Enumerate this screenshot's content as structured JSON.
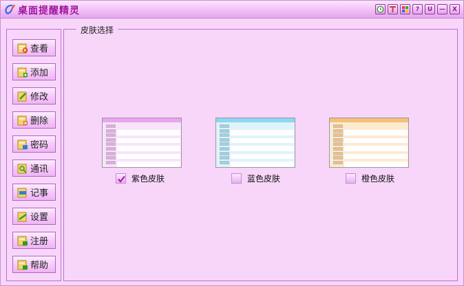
{
  "window": {
    "title": "桌面提醒精灵",
    "accent": "#a0169e",
    "toolbar_buttons": [
      {
        "name": "clock-button",
        "glyph": "◷"
      },
      {
        "name": "pin-button",
        "glyph": "T"
      },
      {
        "name": "skin-button",
        "glyph": "▦"
      },
      {
        "name": "help-button",
        "glyph": "?"
      },
      {
        "name": "magnet-button",
        "glyph": "U"
      },
      {
        "name": "minimize-button",
        "glyph": "—"
      },
      {
        "name": "close-button",
        "glyph": "X"
      }
    ]
  },
  "sidebar": {
    "items": [
      {
        "label": "查看",
        "icon": "view-icon"
      },
      {
        "label": "添加",
        "icon": "add-icon"
      },
      {
        "label": "修改",
        "icon": "edit-icon"
      },
      {
        "label": "删除",
        "icon": "delete-icon"
      },
      {
        "label": "密码",
        "icon": "password-icon"
      },
      {
        "label": "通讯",
        "icon": "contacts-icon"
      },
      {
        "label": "记事",
        "icon": "notes-icon"
      },
      {
        "label": "设置",
        "icon": "settings-icon"
      },
      {
        "label": "注册",
        "icon": "register-icon"
      },
      {
        "label": "帮助",
        "icon": "help-icon"
      }
    ]
  },
  "skin_panel": {
    "legend": "皮肤选择",
    "skins": [
      {
        "label": "紫色皮肤",
        "checked": true,
        "color": "#e9a4f0",
        "stripe": "#f9e3fb"
      },
      {
        "label": "蓝色皮肤",
        "checked": false,
        "color": "#8fd6f2",
        "stripe": "#dff3fb"
      },
      {
        "label": "橙色皮肤",
        "checked": false,
        "color": "#f6c07a",
        "stripe": "#fdebd0"
      }
    ]
  }
}
